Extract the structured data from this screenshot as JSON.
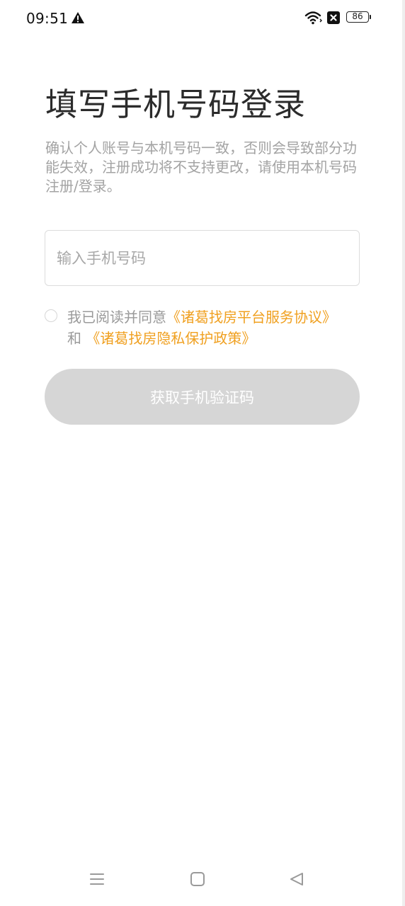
{
  "status_bar": {
    "time": "09:51",
    "battery": "86",
    "icons": [
      "warning-icon",
      "wifi-icon",
      "no-signal-icon",
      "battery-icon"
    ]
  },
  "login": {
    "title": "填写手机号码登录",
    "description": "确认个人账号与本机号码一致，否则会导致部分功能失效，注册成功将不支持更改，请使用本机号码注册/登录。",
    "phone_input": {
      "placeholder": "输入手机号码",
      "value": ""
    },
    "agreement": {
      "checked": false,
      "prefix": "我已阅读并同意",
      "service_link": "《诸葛找房平台服务协议》",
      "joiner": "和",
      "privacy_link": "《诸葛找房隐私保护政策》"
    },
    "submit_label": "获取手机验证码"
  },
  "colors": {
    "accent_link": "#f0a020",
    "button_disabled": "#d6d6d6",
    "hint_text": "#a3a3a3"
  },
  "nav_bar": {
    "icons": [
      "menu-icon",
      "home-icon",
      "back-icon"
    ]
  }
}
